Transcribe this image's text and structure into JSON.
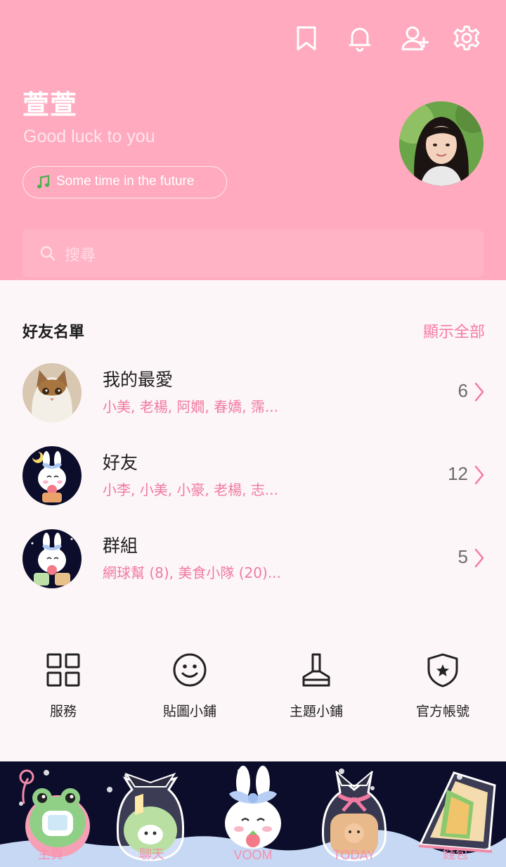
{
  "header": {
    "profile_name": "萱萱",
    "status_message": "Good luck to you",
    "music_title": "Some time in the future",
    "icons": [
      "bookmark-icon",
      "bell-icon",
      "add-friend-icon",
      "gear-icon"
    ]
  },
  "search": {
    "placeholder": "搜尋"
  },
  "friends": {
    "title": "好友名單",
    "show_all": "顯示全部",
    "rows": [
      {
        "title": "我的最愛",
        "subtitle": "小美, 老楊, 阿嫺, 春嬌, 霈...",
        "count": "6"
      },
      {
        "title": "好友",
        "subtitle": "小李, 小美, 小豪, 老楊, 志...",
        "count": "12"
      },
      {
        "title": "群組",
        "subtitle": "網球幫 (8), 美食小隊 (20)...",
        "count": "5"
      }
    ]
  },
  "services": [
    {
      "label": "服務",
      "icon": "grid-icon"
    },
    {
      "label": "貼圖小鋪",
      "icon": "smiley-icon"
    },
    {
      "label": "主題小鋪",
      "icon": "brush-icon"
    },
    {
      "label": "官方帳號",
      "icon": "shield-star-icon"
    }
  ],
  "tabs": [
    {
      "label": "主頁",
      "icon": "frog-icon"
    },
    {
      "label": "聊天",
      "icon": "cake-bag-icon"
    },
    {
      "label": "VOOM",
      "icon": "bunny-icon"
    },
    {
      "label": "TODAY",
      "icon": "bread-bag-icon"
    },
    {
      "label": "錢包",
      "icon": "sandwich-icon"
    }
  ],
  "colors": {
    "header_bg": "#ffaabf",
    "accent_pink": "#f47aa2",
    "tabbar_bg": "#0c0d2a",
    "page_bg": "#fdf6f8"
  }
}
